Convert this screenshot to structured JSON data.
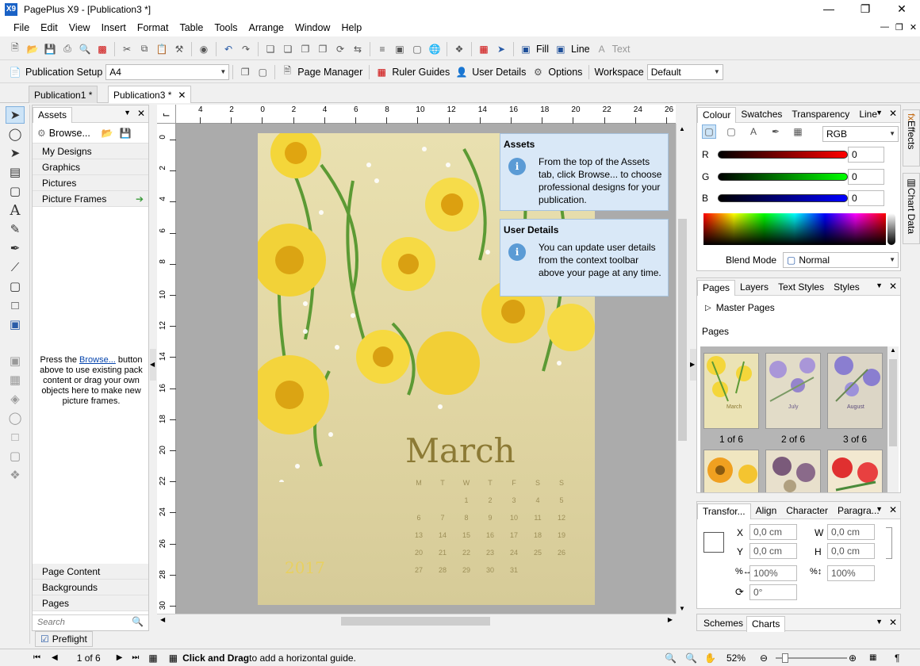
{
  "window": {
    "title": "PagePlus X9 - [Publication3 *]",
    "logo": "X9"
  },
  "menu": [
    "File",
    "Edit",
    "View",
    "Insert",
    "Format",
    "Table",
    "Tools",
    "Arrange",
    "Window",
    "Help"
  ],
  "toolbar2": {
    "publication_setup": "Publication Setup",
    "page_size": "A4",
    "page_manager": "Page Manager",
    "ruler_guides": "Ruler Guides",
    "user_details": "User Details",
    "options": "Options",
    "workspace_label": "Workspace",
    "workspace_value": "Default"
  },
  "toolbar1": {
    "fill": "Fill",
    "line": "Line",
    "text": "Text"
  },
  "doc_tabs": [
    "Publication1 *",
    "Publication3 *"
  ],
  "assets": {
    "tab": "Assets",
    "browse": "Browse...",
    "categories": [
      "My Designs",
      "Graphics",
      "Pictures",
      "Picture Frames"
    ],
    "hint_before": "Press the ",
    "hint_link": "Browse...",
    "hint_after": " button above to use existing pack content or drag your own objects here to make new picture frames.",
    "bottom_sections": [
      "Page Content",
      "Backgrounds",
      "Pages"
    ],
    "search_placeholder": "Search"
  },
  "ruler_h": [
    "4",
    "2",
    "0",
    "2",
    "4",
    "6",
    "8",
    "10",
    "12",
    "14",
    "16",
    "18",
    "20",
    "22",
    "24",
    "26"
  ],
  "ruler_v": [
    "0",
    "2",
    "4",
    "6",
    "8",
    "10",
    "12",
    "14",
    "16",
    "18",
    "20",
    "22",
    "24",
    "26",
    "28",
    "30"
  ],
  "calendar": {
    "month": "March",
    "year": "2017",
    "days": [
      "M",
      "T",
      "W",
      "T",
      "F",
      "S",
      "S"
    ],
    "rows": [
      [
        "",
        "",
        "1",
        "2",
        "3",
        "4",
        "5"
      ],
      [
        "6",
        "7",
        "8",
        "9",
        "10",
        "11",
        "12"
      ],
      [
        "13",
        "14",
        "15",
        "16",
        "17",
        "18",
        "19"
      ],
      [
        "20",
        "21",
        "22",
        "23",
        "24",
        "25",
        "26"
      ],
      [
        "27",
        "28",
        "29",
        "30",
        "31",
        "",
        ""
      ]
    ]
  },
  "tooltips": [
    {
      "title": "Assets",
      "text": "From the top of the Assets tab, click Browse... to choose professional designs for your publication."
    },
    {
      "title": "User Details",
      "text": "You can update user details from the context toolbar above your page at any time."
    }
  ],
  "colour_panel": {
    "tabs": [
      "Colour",
      "Swatches",
      "Transparency",
      "Line"
    ],
    "model": "RGB",
    "channels": [
      {
        "label": "R",
        "value": "0",
        "color": "#d00000"
      },
      {
        "label": "G",
        "value": "0",
        "color": "#00b000"
      },
      {
        "label": "B",
        "value": "0",
        "color": "#0000c8"
      }
    ],
    "blend_label": "Blend Mode",
    "blend_value": "Normal"
  },
  "pages_panel": {
    "tabs": [
      "Pages",
      "Layers",
      "Text Styles",
      "Styles"
    ],
    "master_pages": "Master Pages",
    "pages_label": "Pages",
    "thumbs": [
      {
        "label": "1 of 6",
        "caption": "March"
      },
      {
        "label": "2 of 6",
        "caption": "July"
      },
      {
        "label": "3 of 6",
        "caption": "August"
      }
    ]
  },
  "transform_panel": {
    "tabs": [
      "Transfor...",
      "Align",
      "Character",
      "Paragra..."
    ],
    "x_label": "X",
    "x_value": "0,0 cm",
    "y_label": "Y",
    "y_value": "0,0 cm",
    "w_label": "W",
    "w_value": "0,0 cm",
    "h_label": "H",
    "h_value": "0,0 cm",
    "scale_w": "100%",
    "scale_h": "100%",
    "rotation": "0°"
  },
  "bottom_tabs": [
    "Schemes",
    "Charts"
  ],
  "side_tabs": [
    "Effects",
    "Chart Data"
  ],
  "preflight": "Preflight",
  "status": {
    "page": "1 of 6",
    "hint_bold": "Click and Drag",
    "hint_rest": " to add a horizontal guide.",
    "zoom": "52%"
  }
}
